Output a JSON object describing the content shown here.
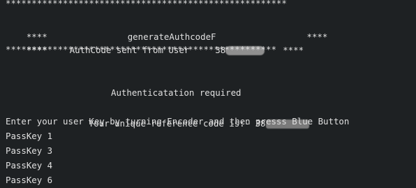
{
  "terminal": {
    "lines": {
      "stars_top": "******************************************************",
      "title_prefix": "****",
      "title_text": "generateAuthcodeF",
      "title_suffix": "****",
      "authcode_prefix": "****",
      "authcode_text": "AuthCode sent from User",
      "authcode_value_visible": "38",
      "authcode_suffix": "****",
      "stars_bottom": "****************************************************",
      "auth_required": "Authenticatation required",
      "refcode_label": "Your unique reference code is:-",
      "refcode_value_visible": "38",
      "instruction": "Enter your user Key by turning Encoder and then presss Blue Button",
      "passkeys": [
        "PassKey 1",
        "PassKey 3",
        "PassKey 4",
        "PassKey 6"
      ]
    }
  }
}
